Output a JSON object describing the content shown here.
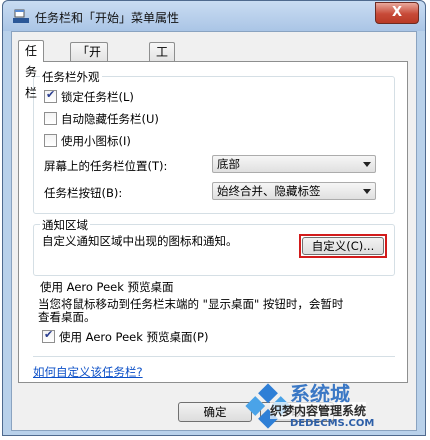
{
  "window": {
    "title": "任务栏和「开始」菜单属性",
    "close_symbol": "X"
  },
  "tabs": [
    {
      "label": "任务栏",
      "active": true
    },
    {
      "label": "「开始」菜单",
      "active": false
    },
    {
      "label": "工具栏",
      "active": false
    }
  ],
  "appearance": {
    "title": "任务栏外观",
    "lock_label": "锁定任务栏(L)",
    "lock_checked": true,
    "autohide_label": "自动隐藏任务栏(U)",
    "autohide_checked": false,
    "small_icons_label": "使用小图标(I)",
    "small_icons_checked": false,
    "position_label": "屏幕上的任务栏位置(T):",
    "position_value": "底部",
    "buttons_label": "任务栏按钮(B):",
    "buttons_value": "始终合并、隐藏标签"
  },
  "notification": {
    "title": "通知区域",
    "description": "自定义通知区域中出现的图标和通知。",
    "customize_label": "自定义(C)..."
  },
  "peek": {
    "title": "使用 Aero Peek 预览桌面",
    "description_line1": "当您将鼠标移动到任务栏末端的 \"显示桌面\" 按钮时，会暂时",
    "description_line2": "查看桌面。",
    "checkbox_label": "使用 Aero Peek 预览桌面(P)",
    "checkbox_checked": true
  },
  "help_link": "如何自定义该任务栏?",
  "footer": {
    "ok_label": "确定",
    "cancel_label": "取"
  },
  "watermark": {
    "brand": "系统城",
    "subtitle": "织梦内容管理系统",
    "url": "DEDECMS.COM"
  }
}
